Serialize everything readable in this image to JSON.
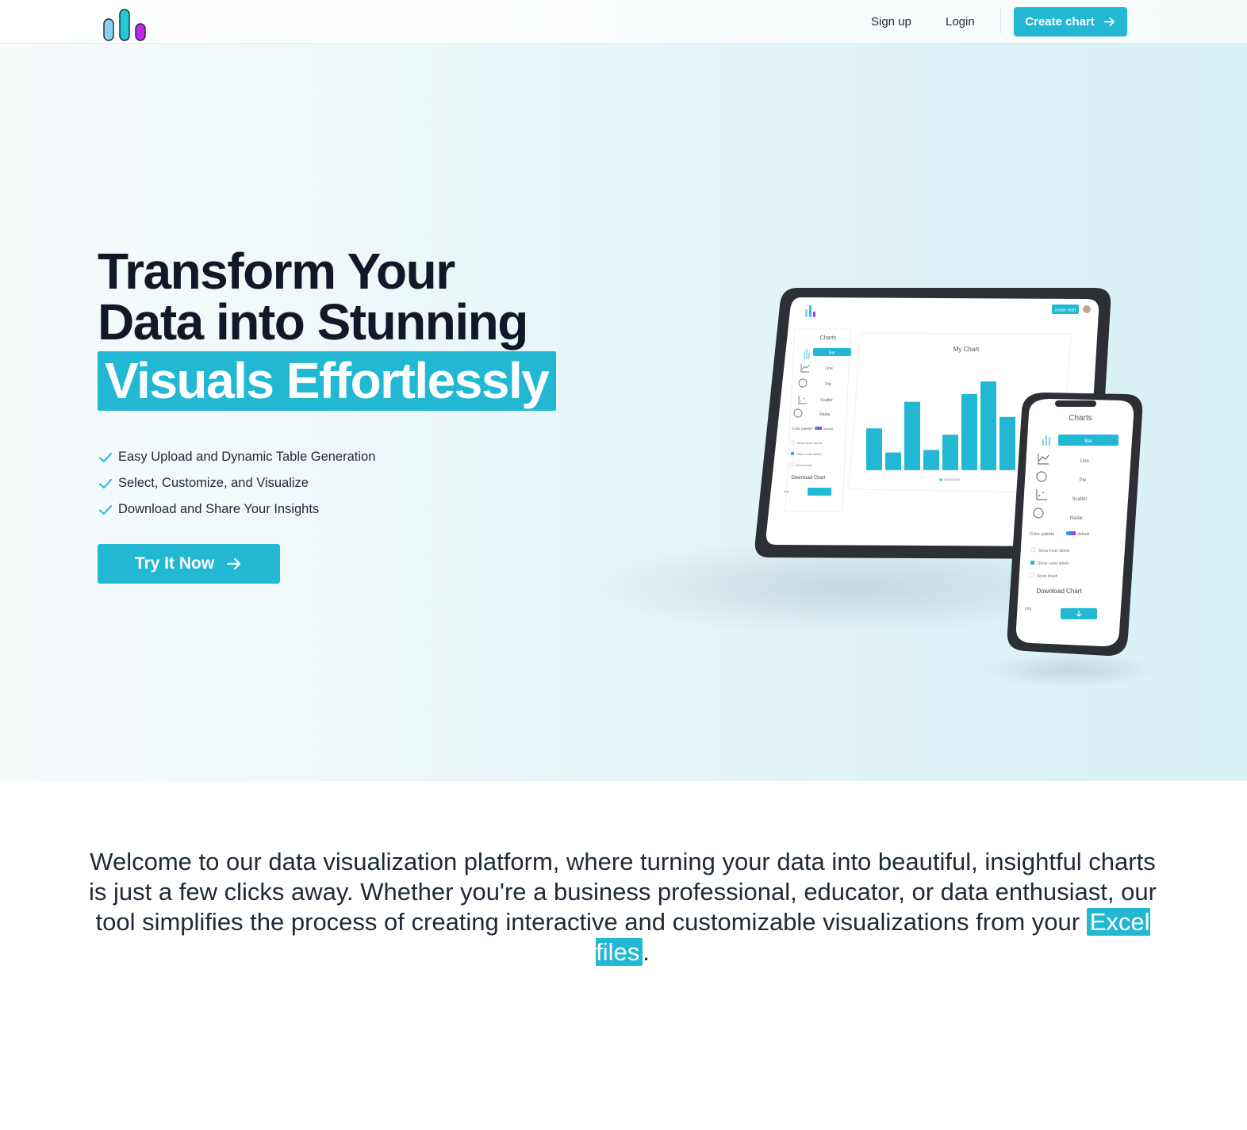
{
  "nav": {
    "signup": "Sign up",
    "login": "Login",
    "create_chart": "Create chart"
  },
  "hero": {
    "title_line1": "Transform Your",
    "title_line2": "Data into Stunning",
    "title_highlight": "Visuals Effortlessly",
    "features": [
      "Easy Upload and Dynamic Table Generation",
      "Select, Customize, and Visualize",
      "Download and Share Your Insights"
    ],
    "cta": "Try It Now"
  },
  "mockup": {
    "tablet": {
      "sidebar_title": "Charts",
      "chart_types": [
        "Bar",
        "Line",
        "Pie",
        "Scatter",
        "Radar"
      ],
      "color_palette_label": "Color palette",
      "palette_value": "default",
      "options": [
        "Show inner labels",
        "Show outer labels",
        "Show brush"
      ],
      "download_label": "Download Chart",
      "format": "png",
      "create_button": "create chart",
      "chart_title": "My Chart"
    },
    "phone": {
      "sidebar_title": "Charts",
      "chart_types": [
        "Bar",
        "Line",
        "Pie",
        "Scatter",
        "Radar"
      ],
      "color_palette_label": "Color palette",
      "palette_value": "default",
      "options": [
        "Show inner labels",
        "Show outer labels",
        "Show brush"
      ],
      "download_label": "Download Chart",
      "format": "png"
    },
    "bar_values": [
      66,
      28,
      108,
      32,
      56,
      120,
      140,
      84
    ]
  },
  "intro": {
    "text": "Welcome to our data visualization platform, where turning your data into beautiful, insightful charts is just a few clicks away. Whether you're a business professional, educator, or data enthusiast, our tool simplifies the process of creating interactive and customizable visualizations from your ",
    "highlight": "Excel files",
    "end": "."
  },
  "colors": {
    "accent": "#22b8d4",
    "heading": "#111827",
    "logo_bar1": "#7cc7f0",
    "logo_bar2": "#22c9d4",
    "logo_bar3": "#c026f0"
  }
}
